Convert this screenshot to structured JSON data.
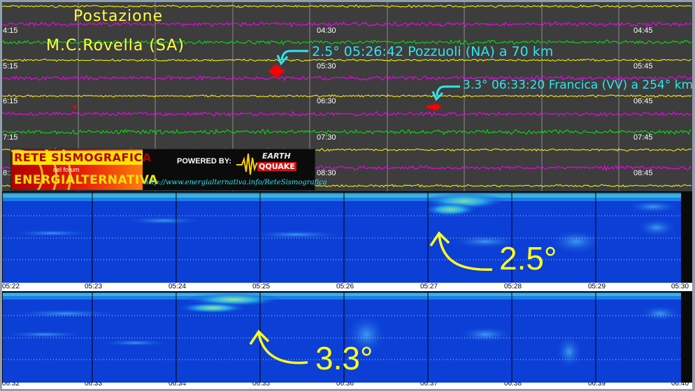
{
  "station": {
    "title_line1": "Postazione",
    "title_line2": "M.C.Rovella (SA)"
  },
  "helicorder": {
    "left_labels": [
      "4:15",
      "5:15",
      "6:15",
      "7:15",
      "8:15"
    ],
    "mid_labels": [
      "04:30",
      "05:30",
      "06:30",
      "07:30",
      "08:30"
    ],
    "right_labels": [
      "04:45",
      "05:45",
      "06:45",
      "07:45",
      "08:45"
    ],
    "trace_colors": [
      "#ffff00",
      "#ff00ff",
      "#00ee00",
      "#ffff00",
      "#ff00ff"
    ],
    "event_color": "#ff0000",
    "annotation_color": "#2ee6ee"
  },
  "events": [
    {
      "text": "2.5° 05:26:42 Pozzuoli (NA)  a 70 km"
    },
    {
      "text": "3.3° 06:33:20 Francica (VV) a 254° km"
    }
  ],
  "banner": {
    "rete": "RETE SISMOGRAFICA",
    "forum": "del forum",
    "energia": "ENERGIALTERNATIVA",
    "powered": "POWERED BY:",
    "earth": "EARTH",
    "qquake": "QQUAKE",
    "url": "http://www.energialternativa.info/ReteSismografica"
  },
  "spectrogram1": {
    "ticks": [
      "05:22",
      "05:23",
      "05:24",
      "05:25",
      "05:26",
      "05:27",
      "05:28",
      "05:29",
      "05:30"
    ],
    "magnitude_label": "2.5°"
  },
  "spectrogram2": {
    "ticks": [
      "06:32",
      "06:33",
      "06:34",
      "06:35",
      "06:36",
      "06:37",
      "06:38",
      "06:39",
      "06:40"
    ],
    "magnitude_label": "3.3°"
  }
}
